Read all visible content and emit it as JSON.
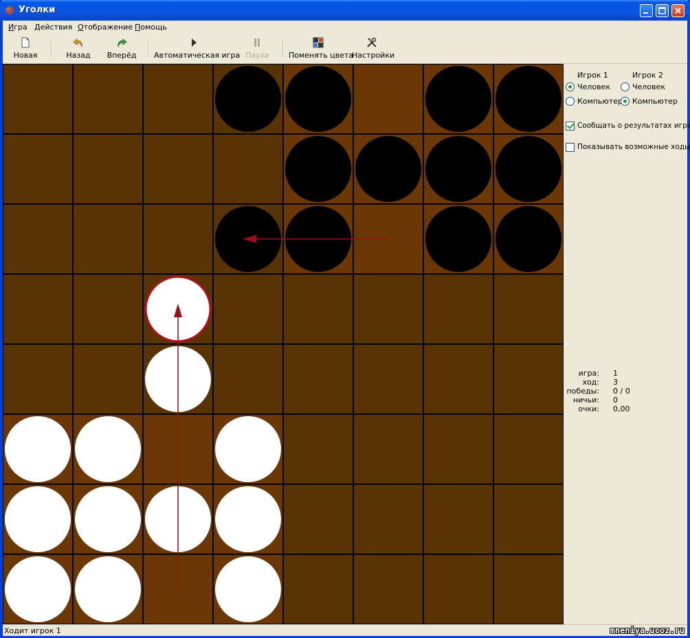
{
  "window": {
    "title": "Уголки"
  },
  "menu": [
    {
      "accel": "И",
      "rest": "гра"
    },
    {
      "accel": "Д",
      "rest": "ействия"
    },
    {
      "accel": "О",
      "rest": "тображение"
    },
    {
      "accel": "П",
      "rest": "омощь"
    }
  ],
  "toolbar": {
    "new": "Новая",
    "back": "Назад",
    "forward": "Вперёд",
    "auto": "Автоматическая игра",
    "pause": "Пауза",
    "swap": "Поменять цвета",
    "settings": "Настройки"
  },
  "colors": {
    "dark_square": "#583305",
    "light_square": "#6B3705",
    "grid": "#1E1204",
    "black_piece": "#000000",
    "white_piece": "#FFFFFF",
    "selection": "#B01018",
    "arrow": "#9B0F16"
  },
  "board": {
    "size": 8,
    "black": [
      [
        0,
        3
      ],
      [
        0,
        4
      ],
      [
        0,
        6
      ],
      [
        0,
        7
      ],
      [
        1,
        4
      ],
      [
        1,
        5
      ],
      [
        1,
        6
      ],
      [
        1,
        7
      ],
      [
        2,
        3
      ],
      [
        2,
        4
      ],
      [
        2,
        6
      ],
      [
        2,
        7
      ]
    ],
    "white": [
      [
        3,
        2
      ],
      [
        4,
        2
      ],
      [
        5,
        0
      ],
      [
        5,
        1
      ],
      [
        5,
        3
      ],
      [
        6,
        0
      ],
      [
        6,
        1
      ],
      [
        6,
        2
      ],
      [
        6,
        3
      ],
      [
        7,
        0
      ],
      [
        7,
        1
      ],
      [
        7,
        3
      ]
    ],
    "selected": [
      3,
      2
    ],
    "moves": [
      {
        "from": [
          2,
          5
        ],
        "to": [
          2,
          3
        ]
      },
      {
        "from": [
          7,
          2
        ],
        "to": [
          3,
          2
        ]
      }
    ]
  },
  "side": {
    "player1_label": "Игрок 1",
    "player2_label": "Игрок 2",
    "human": "Человек",
    "computer": "Компьютер",
    "report_results": "Сообщать о результатах игры",
    "show_moves": "Показывать возможные ходы",
    "stats": [
      {
        "key": "игра:",
        "value": "1"
      },
      {
        "key": "ход:",
        "value": "3"
      },
      {
        "key": "победы:",
        "value": "0 / 0"
      },
      {
        "key": "ничьи:",
        "value": "0"
      },
      {
        "key": "очки:",
        "value": "0,00"
      }
    ]
  },
  "status": {
    "text": "Ходит игрок 1",
    "watermark": "mneniya.ucoz.ru"
  }
}
